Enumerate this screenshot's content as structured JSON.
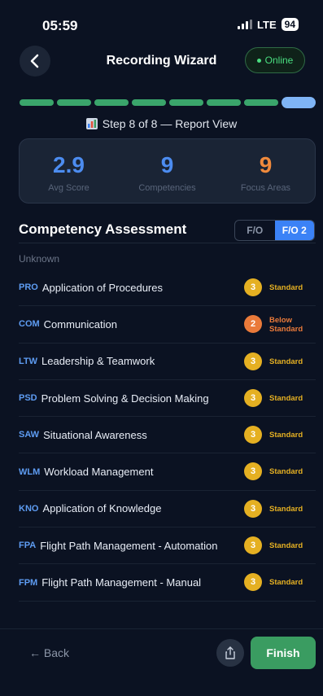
{
  "status_bar": {
    "time": "05:59",
    "network": "LTE",
    "battery": "94"
  },
  "header": {
    "title": "Recording Wizard",
    "online_label": "Online"
  },
  "progress": {
    "current_step": 8,
    "total_steps": 8,
    "label": "Step 8 of 8 — Report View"
  },
  "stats": [
    {
      "value": "2.9",
      "label": "Avg Score",
      "color": "#4c8cf0"
    },
    {
      "value": "9",
      "label": "Competencies",
      "color": "#4c8cf0"
    },
    {
      "value": "9",
      "label": "Focus Areas",
      "color": "#f08a3c"
    }
  ],
  "section": {
    "title": "Competency Assessment",
    "toggle": [
      {
        "label": "F/O",
        "active": false
      },
      {
        "label": "F/O 2",
        "active": true
      }
    ],
    "subtitle": "Unknown"
  },
  "competencies": [
    {
      "code": "PRO",
      "name": "Application of Procedures",
      "score": "3",
      "rating": "Standard",
      "color": "#e5b022"
    },
    {
      "code": "COM",
      "name": "Communication",
      "score": "2",
      "rating": "Below\nStandard",
      "color": "#ea7a3a"
    },
    {
      "code": "LTW",
      "name": "Leadership & Teamwork",
      "score": "3",
      "rating": "Standard",
      "color": "#e5b022"
    },
    {
      "code": "PSD",
      "name": "Problem Solving & Decision Making",
      "score": "3",
      "rating": "Standard",
      "color": "#e5b022"
    },
    {
      "code": "SAW",
      "name": "Situational Awareness",
      "score": "3",
      "rating": "Standard",
      "color": "#e5b022"
    },
    {
      "code": "WLM",
      "name": "Workload Management",
      "score": "3",
      "rating": "Standard",
      "color": "#e5b022"
    },
    {
      "code": "KNO",
      "name": "Application of Knowledge",
      "score": "3",
      "rating": "Standard",
      "color": "#e5b022"
    },
    {
      "code": "FPA",
      "name": "Flight Path Management - Automation",
      "score": "3",
      "rating": "Standard",
      "color": "#e5b022"
    },
    {
      "code": "FPM",
      "name": "Flight Path Management - Manual",
      "score": "3",
      "rating": "Standard",
      "color": "#e5b022"
    }
  ],
  "footer": {
    "back_label": "← Back",
    "finish_label": "Finish",
    "share_icon": "share-icon"
  }
}
